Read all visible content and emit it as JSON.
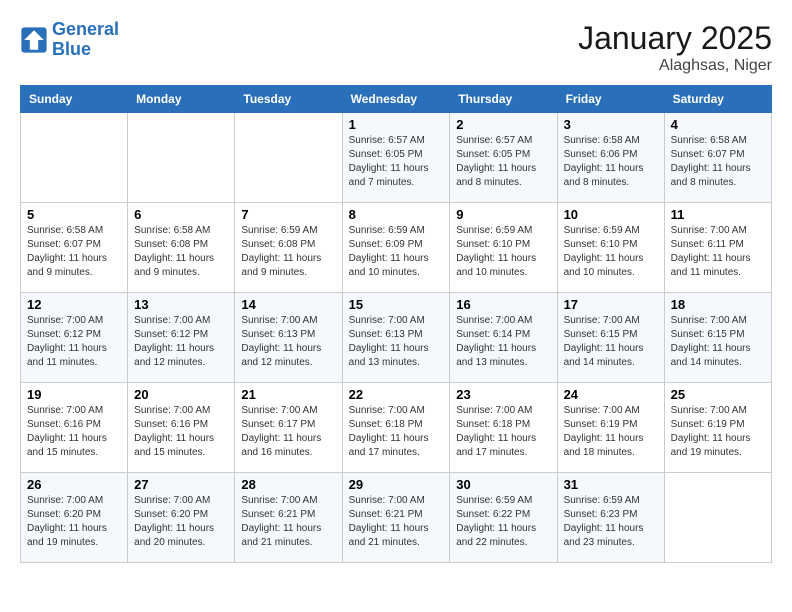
{
  "logo": {
    "line1": "General",
    "line2": "Blue"
  },
  "title": "January 2025",
  "location": "Alaghsas, Niger",
  "weekdays": [
    "Sunday",
    "Monday",
    "Tuesday",
    "Wednesday",
    "Thursday",
    "Friday",
    "Saturday"
  ],
  "weeks": [
    [
      {
        "day": "",
        "info": ""
      },
      {
        "day": "",
        "info": ""
      },
      {
        "day": "",
        "info": ""
      },
      {
        "day": "1",
        "info": "Sunrise: 6:57 AM\nSunset: 6:05 PM\nDaylight: 11 hours\nand 7 minutes."
      },
      {
        "day": "2",
        "info": "Sunrise: 6:57 AM\nSunset: 6:05 PM\nDaylight: 11 hours\nand 8 minutes."
      },
      {
        "day": "3",
        "info": "Sunrise: 6:58 AM\nSunset: 6:06 PM\nDaylight: 11 hours\nand 8 minutes."
      },
      {
        "day": "4",
        "info": "Sunrise: 6:58 AM\nSunset: 6:07 PM\nDaylight: 11 hours\nand 8 minutes."
      }
    ],
    [
      {
        "day": "5",
        "info": "Sunrise: 6:58 AM\nSunset: 6:07 PM\nDaylight: 11 hours\nand 9 minutes."
      },
      {
        "day": "6",
        "info": "Sunrise: 6:58 AM\nSunset: 6:08 PM\nDaylight: 11 hours\nand 9 minutes."
      },
      {
        "day": "7",
        "info": "Sunrise: 6:59 AM\nSunset: 6:08 PM\nDaylight: 11 hours\nand 9 minutes."
      },
      {
        "day": "8",
        "info": "Sunrise: 6:59 AM\nSunset: 6:09 PM\nDaylight: 11 hours\nand 10 minutes."
      },
      {
        "day": "9",
        "info": "Sunrise: 6:59 AM\nSunset: 6:10 PM\nDaylight: 11 hours\nand 10 minutes."
      },
      {
        "day": "10",
        "info": "Sunrise: 6:59 AM\nSunset: 6:10 PM\nDaylight: 11 hours\nand 10 minutes."
      },
      {
        "day": "11",
        "info": "Sunrise: 7:00 AM\nSunset: 6:11 PM\nDaylight: 11 hours\nand 11 minutes."
      }
    ],
    [
      {
        "day": "12",
        "info": "Sunrise: 7:00 AM\nSunset: 6:12 PM\nDaylight: 11 hours\nand 11 minutes."
      },
      {
        "day": "13",
        "info": "Sunrise: 7:00 AM\nSunset: 6:12 PM\nDaylight: 11 hours\nand 12 minutes."
      },
      {
        "day": "14",
        "info": "Sunrise: 7:00 AM\nSunset: 6:13 PM\nDaylight: 11 hours\nand 12 minutes."
      },
      {
        "day": "15",
        "info": "Sunrise: 7:00 AM\nSunset: 6:13 PM\nDaylight: 11 hours\nand 13 minutes."
      },
      {
        "day": "16",
        "info": "Sunrise: 7:00 AM\nSunset: 6:14 PM\nDaylight: 11 hours\nand 13 minutes."
      },
      {
        "day": "17",
        "info": "Sunrise: 7:00 AM\nSunset: 6:15 PM\nDaylight: 11 hours\nand 14 minutes."
      },
      {
        "day": "18",
        "info": "Sunrise: 7:00 AM\nSunset: 6:15 PM\nDaylight: 11 hours\nand 14 minutes."
      }
    ],
    [
      {
        "day": "19",
        "info": "Sunrise: 7:00 AM\nSunset: 6:16 PM\nDaylight: 11 hours\nand 15 minutes."
      },
      {
        "day": "20",
        "info": "Sunrise: 7:00 AM\nSunset: 6:16 PM\nDaylight: 11 hours\nand 15 minutes."
      },
      {
        "day": "21",
        "info": "Sunrise: 7:00 AM\nSunset: 6:17 PM\nDaylight: 11 hours\nand 16 minutes."
      },
      {
        "day": "22",
        "info": "Sunrise: 7:00 AM\nSunset: 6:18 PM\nDaylight: 11 hours\nand 17 minutes."
      },
      {
        "day": "23",
        "info": "Sunrise: 7:00 AM\nSunset: 6:18 PM\nDaylight: 11 hours\nand 17 minutes."
      },
      {
        "day": "24",
        "info": "Sunrise: 7:00 AM\nSunset: 6:19 PM\nDaylight: 11 hours\nand 18 minutes."
      },
      {
        "day": "25",
        "info": "Sunrise: 7:00 AM\nSunset: 6:19 PM\nDaylight: 11 hours\nand 19 minutes."
      }
    ],
    [
      {
        "day": "26",
        "info": "Sunrise: 7:00 AM\nSunset: 6:20 PM\nDaylight: 11 hours\nand 19 minutes."
      },
      {
        "day": "27",
        "info": "Sunrise: 7:00 AM\nSunset: 6:20 PM\nDaylight: 11 hours\nand 20 minutes."
      },
      {
        "day": "28",
        "info": "Sunrise: 7:00 AM\nSunset: 6:21 PM\nDaylight: 11 hours\nand 21 minutes."
      },
      {
        "day": "29",
        "info": "Sunrise: 7:00 AM\nSunset: 6:21 PM\nDaylight: 11 hours\nand 21 minutes."
      },
      {
        "day": "30",
        "info": "Sunrise: 6:59 AM\nSunset: 6:22 PM\nDaylight: 11 hours\nand 22 minutes."
      },
      {
        "day": "31",
        "info": "Sunrise: 6:59 AM\nSunset: 6:23 PM\nDaylight: 11 hours\nand 23 minutes."
      },
      {
        "day": "",
        "info": ""
      }
    ]
  ]
}
